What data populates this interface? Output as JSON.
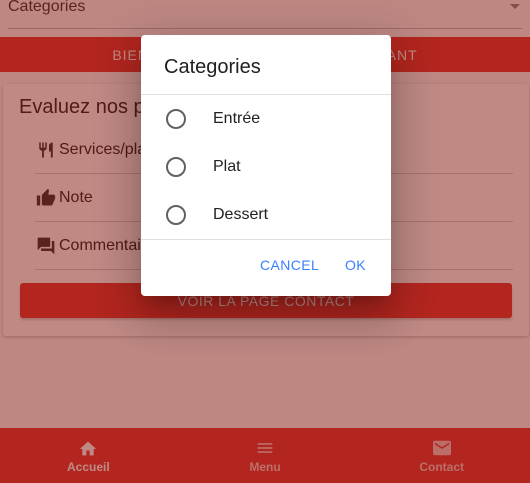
{
  "category_select": {
    "value": "Categories"
  },
  "banner": {
    "text": "BIENVENUE DANS NOTRE RESTAURANT"
  },
  "rating": {
    "title": "Evaluez nos prestations",
    "rows": [
      {
        "label": "Services/plats",
        "icon": "fork-knife-icon"
      },
      {
        "label": "Note",
        "icon": "thumbs-up-icon"
      },
      {
        "label": "Commentaire",
        "icon": "chat-icon"
      }
    ],
    "contact_button": "VOIR LA PAGE CONTACT"
  },
  "tabs": [
    {
      "label": "Accueil",
      "icon": "home-icon",
      "active": true
    },
    {
      "label": "Menu",
      "icon": "menu-icon",
      "active": false
    },
    {
      "label": "Contact",
      "icon": "mail-icon",
      "active": false
    }
  ],
  "dialog": {
    "title": "Categories",
    "options": [
      "Entrée",
      "Plat",
      "Dessert"
    ],
    "cancel_label": "CANCEL",
    "ok_label": "OK"
  },
  "colors": {
    "primary": "#e53935",
    "backdrop": "#80140a",
    "dialog_button": "#3880ff"
  }
}
